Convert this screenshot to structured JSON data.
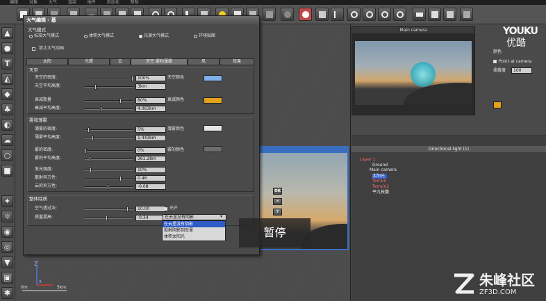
{
  "menubar": {
    "items": [
      "编辑",
      "对象",
      "大气",
      "渲染",
      "插件",
      "自动化",
      "帮助"
    ]
  },
  "dialog": {
    "title": "大气编辑 - 基",
    "mode_group": "大气模式",
    "modes": [
      "标准大气模式",
      "体积大气模式",
      "光谱大气模式",
      "环境贴图"
    ],
    "disable_anim": "禁止大气动画",
    "tabs": [
      "太阳",
      "光照",
      "云",
      "天空 雾和薄雾",
      "风",
      "效果"
    ],
    "sky": {
      "group": "天空",
      "rows": [
        {
          "label": "天空的密度:",
          "value": "100%"
        },
        {
          "label": "天空平均高度:",
          "value": "3km"
        },
        {
          "label": "衰减数量",
          "value": "80%"
        },
        {
          "label": "衰减平均高度:",
          "value": "4.063km"
        }
      ],
      "sky_color_label": "天空颜色",
      "decay_color_label": "衰减颜色",
      "sky_color": "#7fb0e8",
      "decay_color": "#e3a21a"
    },
    "fog": {
      "group": "雾和薄雾",
      "rows": [
        {
          "label": "薄雾的密度:",
          "value": "5%"
        },
        {
          "label": "薄雾平均高度:",
          "value": "1.443km"
        },
        {
          "label": "雾的密度:",
          "value": "0%"
        },
        {
          "label": "雾的平均高度:",
          "value": "361.28m"
        },
        {
          "label": "发光强度:",
          "value": "10%"
        },
        {
          "label": "散射异方性:",
          "value": "0.46"
        },
        {
          "label": "云的异方性:",
          "value": "-0.08"
        }
      ],
      "haze_color_label": "薄雾颜色",
      "fog_color_label": "雾的颜色",
      "haze_color": "#e6e6e6",
      "fog_color": "#6e6e6e"
    },
    "global": {
      "group": "整体除质",
      "rows": [
        {
          "label": "空气透过法:",
          "value": "10.00"
        },
        {
          "label": "质量提高:",
          "value": "-0.34"
        }
      ],
      "lights_label": "光芒",
      "select_value": "在云里没有阴影",
      "options": [
        "在云里没有阴影",
        "投射阴影到云里",
        "体积太阳光"
      ]
    },
    "buttons": [
      "OK",
      "✕",
      "?"
    ]
  },
  "overlay": {
    "pause": "暂停"
  },
  "camera_panel": {
    "title": "Main camera"
  },
  "props": {
    "color_label": "颜色",
    "point_at_camera": "Point at camera",
    "softness_label": "柔散度",
    "softness_value": "100",
    "light_color": "#e3a21a"
  },
  "tree": {
    "title": "Directional light (1)",
    "items": [
      {
        "label": "Layer 1",
        "style": "red"
      },
      {
        "label": "Ground",
        "style": ""
      },
      {
        "label": "Main camera",
        "style": ""
      },
      {
        "label": "太阳光",
        "style": "hl"
      },
      {
        "label": "Terrain",
        "style": "red"
      },
      {
        "label": "Terrain2",
        "style": "red"
      },
      {
        "label": "平九枝腹",
        "style": ""
      }
    ]
  },
  "viewport": {
    "scale_start": "0m",
    "scale_end": "5km"
  },
  "watermarks": {
    "top_logo": "YOUKU",
    "top_cn": "优酷",
    "site_cn": "朱峰社区",
    "site_en": "ZF3D.COM"
  }
}
